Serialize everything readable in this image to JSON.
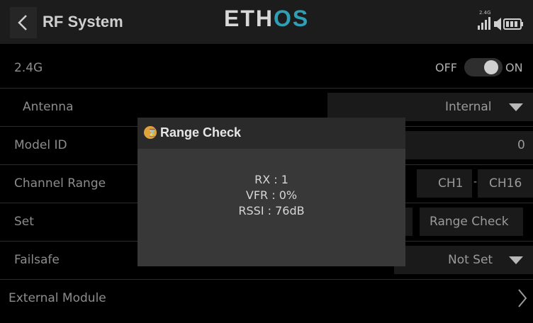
{
  "header": {
    "back_label": "back",
    "title": "RF System",
    "logo_main": "ETH",
    "logo_accent": "OS",
    "freq_label": "2.4G"
  },
  "rows": {
    "rf_24": {
      "label": "2.4G",
      "toggle_off": "OFF",
      "toggle_on": "ON",
      "enabled": true
    },
    "antenna": {
      "label": "Antenna",
      "value": "Internal"
    },
    "model_id": {
      "label": "Model ID",
      "value": "0"
    },
    "channel_range": {
      "label": "Channel Range",
      "start": "CH1",
      "dash": "-",
      "end": "CH16"
    },
    "set": {
      "label": "Set",
      "button": "Range Check"
    },
    "failsafe": {
      "label": "Failsafe",
      "value": "Not Set"
    },
    "external_module": {
      "label": "External Module"
    }
  },
  "dialog": {
    "title": "Range Check",
    "rx": "RX : 1",
    "vfr": "VFR : 0%",
    "rssi": "RSSI  : 76dB"
  },
  "colors": {
    "background": "#000000",
    "header": "#1c1c1c",
    "dialog_body": "#383838",
    "dialog_header": "#2a2a2a",
    "logo_accent": "#2f9fb5",
    "warning_icon": "#e0a23a"
  }
}
